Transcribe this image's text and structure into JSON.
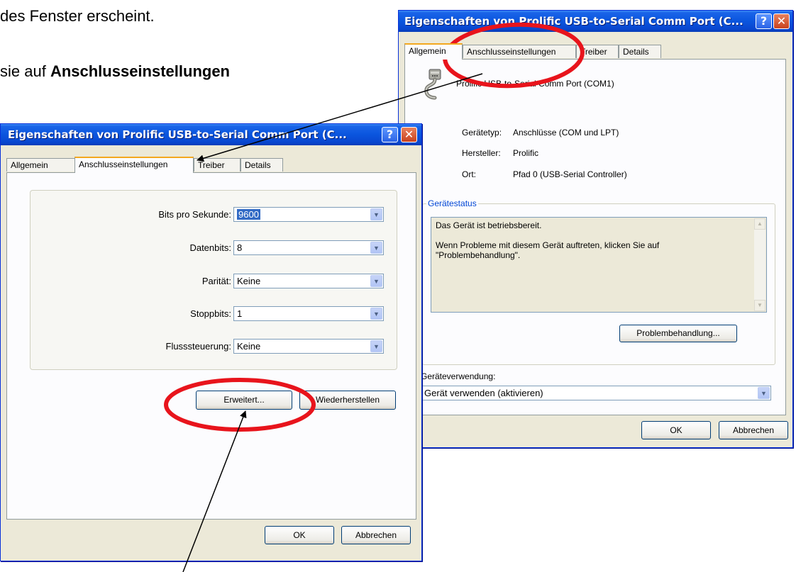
{
  "doc": {
    "line1": "des Fenster erscheint.",
    "line2_prefix": "sie auf ",
    "line2_bold": "Anschlusseinstellungen"
  },
  "dialog_left": {
    "title": "Eigenschaften von Prolific USB-to-Serial Comm Port (C...",
    "help_glyph": "?",
    "close_glyph": "✕",
    "tabs": [
      "Allgemein",
      "Anschlusseinstellungen",
      "Treiber",
      "Details"
    ],
    "active_tab": "Anschlusseinstellungen",
    "fields": {
      "bits_label": "Bits pro Sekunde:",
      "bits_value": "9600",
      "datenbits_label": "Datenbits:",
      "datenbits_value": "8",
      "paritaet_label": "Parität:",
      "paritaet_value": "Keine",
      "stoppbits_label": "Stoppbits:",
      "stoppbits_value": "1",
      "fluss_label": "Flusssteuerung:",
      "fluss_value": "Keine"
    },
    "buttons": {
      "erweitert": "Erweitert...",
      "wiederherstellen": "Wiederherstellen",
      "ok": "OK",
      "abbrechen": "Abbrechen"
    }
  },
  "dialog_right": {
    "title": "Eigenschaften von Prolific USB-to-Serial Comm Port (C...",
    "help_glyph": "?",
    "close_glyph": "✕",
    "tabs": [
      "Allgemein",
      "Anschlusseinstellungen",
      "Treiber",
      "Details"
    ],
    "active_tab": "Allgemein",
    "device_name": "Prolific USB-to-Serial Comm Port (COM1)",
    "geraetetyp_label": "Gerätetyp:",
    "geraetetyp_value": "Anschlüsse (COM und LPT)",
    "hersteller_label": "Hersteller:",
    "hersteller_value": "Prolific",
    "ort_label": "Ort:",
    "ort_value": "Pfad 0 (USB-Serial Controller)",
    "status_group": "Gerätestatus",
    "status_line1": "Das Gerät ist betriebsbereit.",
    "status_line2": "Wenn Probleme mit diesem Gerät auftreten, klicken Sie auf \"Problembehandlung\".",
    "problem_button": "Problembehandlung...",
    "usage_label": "Geräteverwendung:",
    "usage_value": "Gerät verwenden (aktivieren)",
    "buttons": {
      "ok": "OK",
      "abbrechen": "Abbrechen"
    }
  },
  "colors": {
    "annotation_red": "#e8141c",
    "arrow_black": "#000000",
    "title_blue": "#0a55de"
  }
}
